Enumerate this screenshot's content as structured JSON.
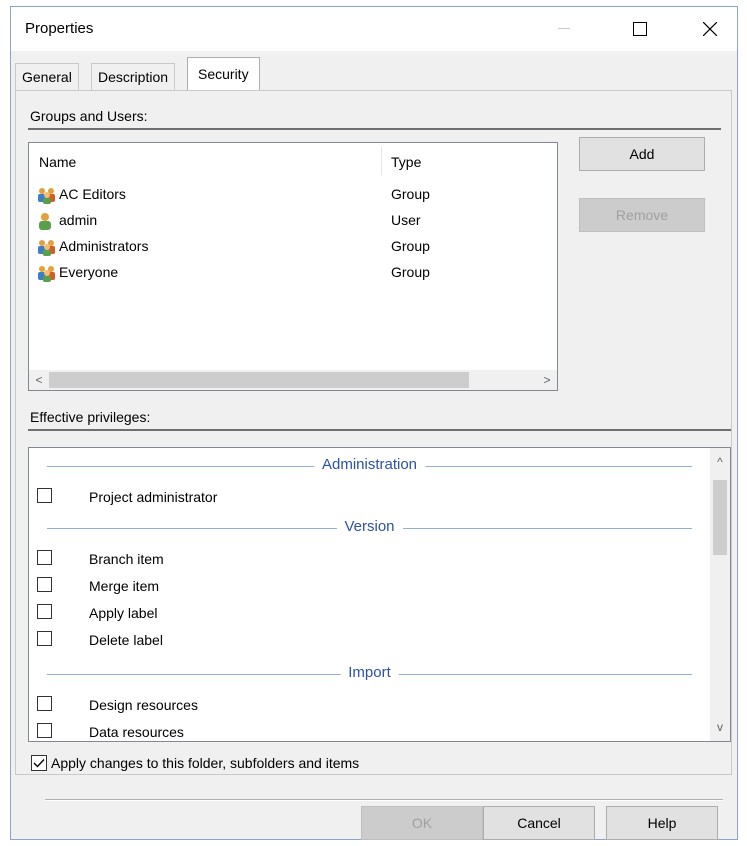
{
  "window": {
    "title": "Properties",
    "minimize_icon": "minimize-icon",
    "maximize_icon": "maximize-icon",
    "close_icon": "close-icon"
  },
  "tabs": [
    {
      "label": "General",
      "active": false
    },
    {
      "label": "Description",
      "active": false
    },
    {
      "label": "Security",
      "active": true
    }
  ],
  "groups_users": {
    "section_label": "Groups and Users:",
    "columns": {
      "name": "Name",
      "type": "Type"
    },
    "rows": [
      {
        "name": "AC Editors",
        "type": "Group",
        "icon": "group-icon"
      },
      {
        "name": "admin",
        "type": "User",
        "icon": "user-icon"
      },
      {
        "name": "Administrators",
        "type": "Group",
        "icon": "group-icon"
      },
      {
        "name": "Everyone",
        "type": "Group",
        "icon": "group-icon"
      }
    ],
    "scroll_left": "<",
    "scroll_right": ">"
  },
  "buttons": {
    "add": "Add",
    "remove": "Remove",
    "ok": "OK",
    "cancel": "Cancel",
    "help": "Help"
  },
  "privileges": {
    "section_label": "Effective privileges:",
    "groups": [
      {
        "title": "Administration",
        "items": [
          "Project administrator"
        ]
      },
      {
        "title": "Version",
        "items": [
          "Branch item",
          "Merge item",
          "Apply label",
          "Delete label"
        ]
      },
      {
        "title": "Import",
        "items": [
          "Design resources",
          "Data resources"
        ]
      }
    ],
    "scroll_up": "^",
    "scroll_down": "v"
  },
  "apply_changes": {
    "label": "Apply changes to this folder, subfolders and items",
    "checked": true
  },
  "colors": {
    "group_title": "#2c52a1",
    "group_line": "#95aed1",
    "window_bg": "#f0f0f0"
  }
}
